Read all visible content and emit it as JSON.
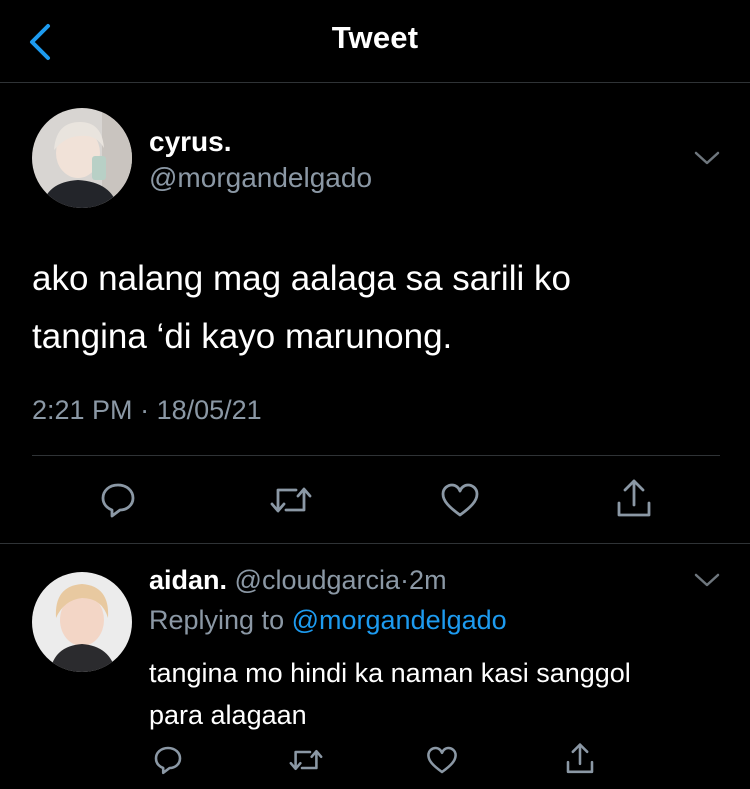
{
  "header": {
    "title": "Tweet",
    "back_icon": "chevron-left-icon"
  },
  "colors": {
    "accent": "#1d9bf0",
    "muted": "#8b98a5",
    "background": "#000000",
    "divider": "#2f3336"
  },
  "main_tweet": {
    "author_name": "cyrus.",
    "author_handle": "@morgandelgado",
    "text_lines": [
      "ako nalang mag aalaga sa sarili ko",
      "tangina ‘di kayo marunong."
    ],
    "time": "2:21 PM",
    "separator": "·",
    "date": "18/05/21",
    "actions": [
      "reply-icon",
      "retweet-icon",
      "like-icon",
      "share-icon"
    ]
  },
  "reply_tweet": {
    "author_name": "aidan.",
    "author_handle": "@cloudgarcia",
    "separator": "·",
    "age": "2m",
    "replying_prefix": "Replying to",
    "replying_to": "@morgandelgado",
    "text_lines": [
      "tangina mo hindi ka naman kasi sanggol",
      "para alagaan"
    ],
    "actions": [
      "reply-icon",
      "retweet-icon",
      "like-icon",
      "share-icon"
    ]
  }
}
